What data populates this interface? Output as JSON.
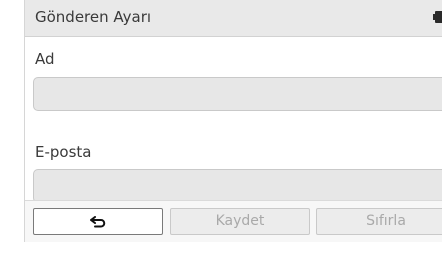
{
  "titlebar": {
    "title": "Gönderen Ayarı",
    "battery_icon": "battery-icon"
  },
  "form": {
    "name_label": "Ad",
    "name_value": "",
    "email_label": "E-posta",
    "email_value": ""
  },
  "bottombar": {
    "back_icon": "back-arrow-icon",
    "save_label": "Kaydet",
    "reset_label": "Sıfırla"
  },
  "colors": {
    "titlebar_bg": "#e9e9e9",
    "input_bg": "#e7e7e7",
    "disabled_text": "#a9a9a9",
    "text": "#3a3a3a"
  }
}
